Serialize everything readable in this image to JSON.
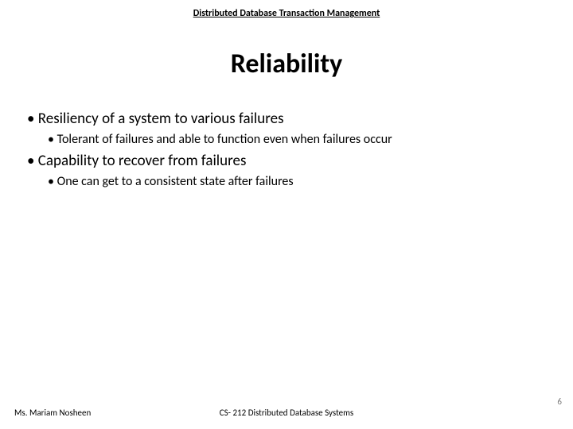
{
  "header": "Distributed Database Transaction Management",
  "title": "Reliability",
  "bullets": [
    {
      "text": "Resiliency of a system to various failures",
      "sub": [
        "Tolerant of failures and able to function even when failures occur"
      ]
    },
    {
      "text": "Capability to recover from failures",
      "sub": [
        "One can get to a consistent state after failures"
      ]
    }
  ],
  "footer": {
    "author": "Ms. Mariam Nosheen",
    "course": "CS- 212 Distributed Database Systems",
    "page": "6"
  }
}
